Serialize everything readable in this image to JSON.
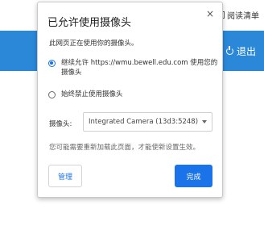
{
  "background": {
    "reading_list_label": "阅读清单",
    "logout_label": "退出"
  },
  "dialog": {
    "title": "已允许使用摄像头",
    "close_symbol": "×",
    "description": "此网页正在使用你的摄像头。",
    "options": [
      {
        "label": "继续允许 https://wmu.bewell.edu.com 使用您的摄像头",
        "checked": true
      },
      {
        "label": "始终禁止使用摄像头",
        "checked": false
      }
    ],
    "camera_label": "摄像头:",
    "camera_selected": "Integrated Camera (13d3:5248)",
    "hint": "您可能需要重新加载此页面，才能使新设置生效。",
    "manage_label": "管理",
    "done_label": "完成"
  },
  "colors": {
    "accent": "#1a73e8",
    "header_bar": "#2b88d9"
  }
}
